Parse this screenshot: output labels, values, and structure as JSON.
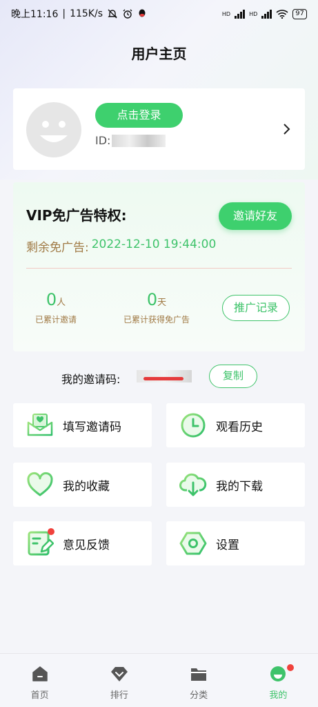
{
  "status_bar": {
    "time": "晚上11:16",
    "speed": "115K/s",
    "battery": "97",
    "hd1": "HD",
    "hd2": "HD"
  },
  "page_title": "用户主页",
  "profile": {
    "login_label": "点击登录",
    "id_prefix": "ID:"
  },
  "vip": {
    "title": "VIP免广告特权:",
    "invite_label": "邀请好友",
    "remain_label": "剩余免广告:",
    "remain_value": "2022-12-10 19:44:00",
    "invited_count": "0",
    "invited_unit": "人",
    "invited_caption": "已累计邀请",
    "earned_count": "0",
    "earned_unit": "天",
    "earned_caption": "已累计获得免广告",
    "promo_label": "推广记录"
  },
  "invite_code": {
    "label": "我的邀请码:",
    "copy_label": "复制"
  },
  "menu": {
    "fill_code": "填写邀请码",
    "history": "观看历史",
    "favorites": "我的收藏",
    "downloads": "我的下载",
    "feedback": "意见反馈",
    "settings": "设置"
  },
  "tabs": [
    {
      "label": "首页",
      "icon": "home-icon"
    },
    {
      "label": "排行",
      "icon": "ranking-icon"
    },
    {
      "label": "分类",
      "icon": "category-icon"
    },
    {
      "label": "我的",
      "icon": "profile-icon"
    }
  ],
  "colors": {
    "accent": "#3ed06e",
    "accent_text": "#3ec36a",
    "label_brown": "#a07a45",
    "badge_red": "#f0423c"
  }
}
